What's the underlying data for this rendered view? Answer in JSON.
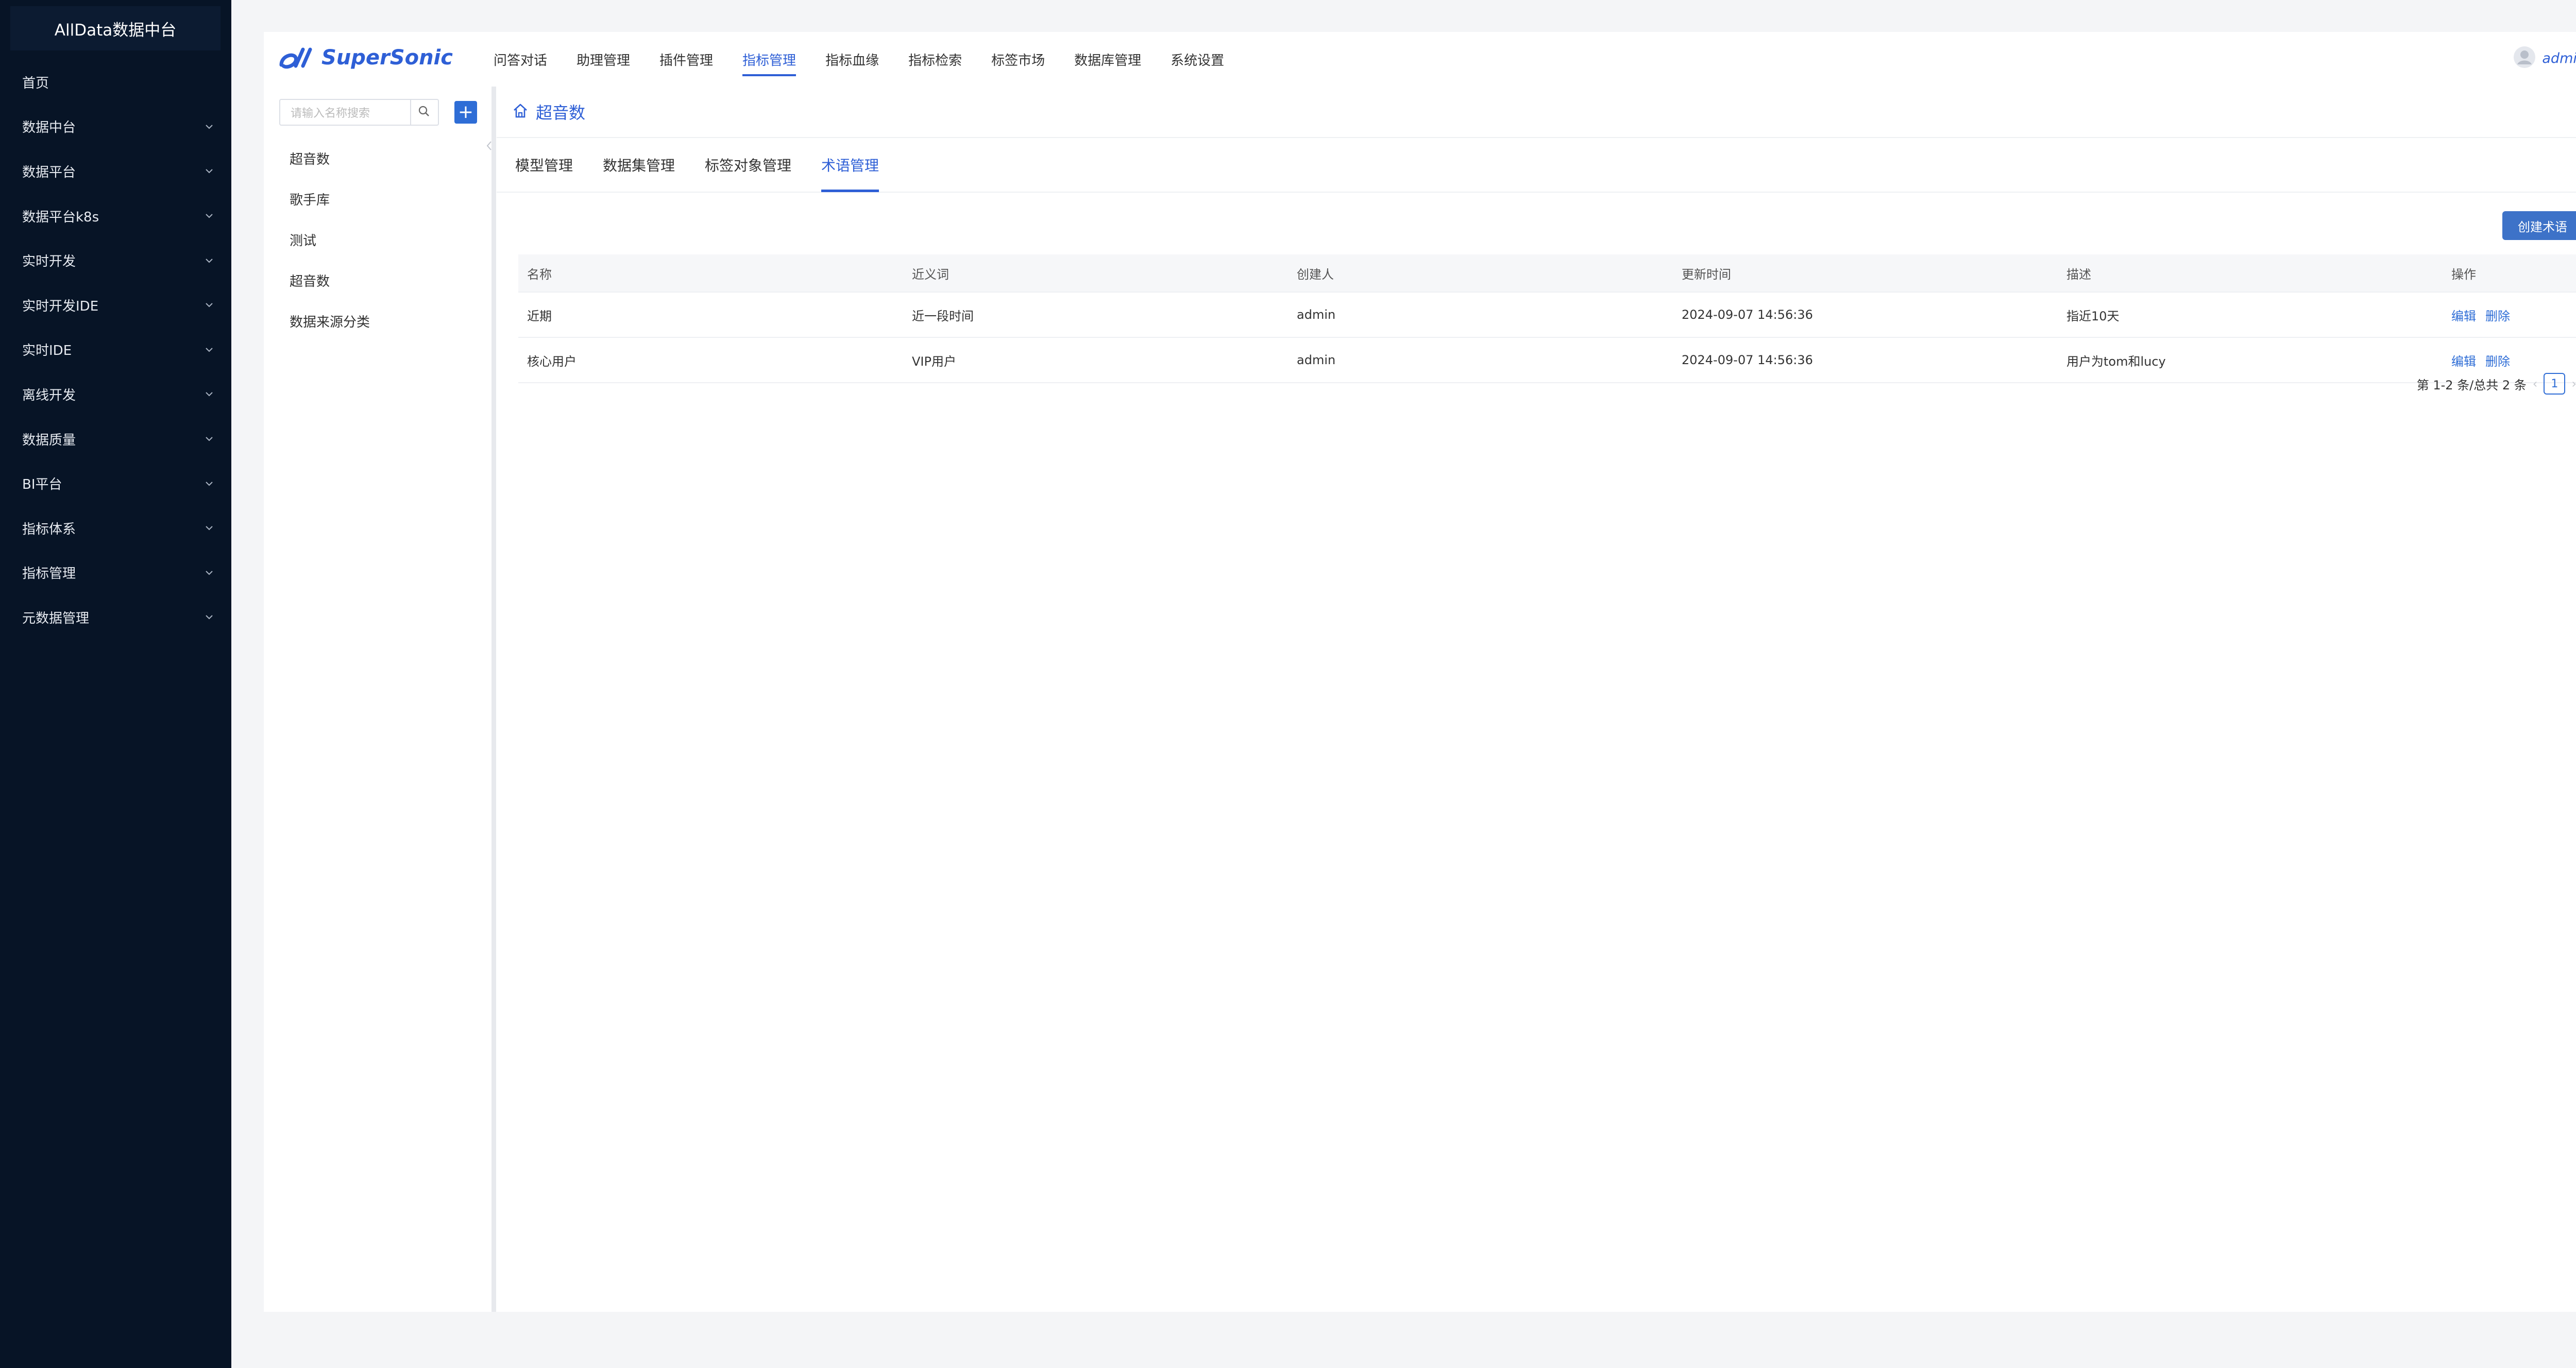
{
  "sidebar": {
    "title": "AllData数据中台",
    "items": [
      {
        "label": "首页",
        "chevron": false
      },
      {
        "label": "数据中台",
        "chevron": true
      },
      {
        "label": "数据平台",
        "chevron": true
      },
      {
        "label": "数据平台k8s",
        "chevron": true
      },
      {
        "label": "实时开发",
        "chevron": true
      },
      {
        "label": "实时开发IDE",
        "chevron": true
      },
      {
        "label": "实时IDE",
        "chevron": true
      },
      {
        "label": "离线开发",
        "chevron": true
      },
      {
        "label": "数据质量",
        "chevron": true
      },
      {
        "label": "BI平台",
        "chevron": true
      },
      {
        "label": "指标体系",
        "chevron": true
      },
      {
        "label": "指标管理",
        "chevron": true
      },
      {
        "label": "元数据管理",
        "chevron": true
      }
    ]
  },
  "header": {
    "logo_text": "SuperSonic",
    "nav": [
      "问答对话",
      "助理管理",
      "插件管理",
      "指标管理",
      "指标血缘",
      "指标检索",
      "标签市场",
      "数据库管理",
      "系统设置"
    ],
    "active_nav": "指标管理",
    "user": "admin"
  },
  "tree": {
    "search_placeholder": "请输入名称搜索",
    "add_label": "+",
    "items": [
      "超音数",
      "歌手库",
      "测试",
      "超音数",
      "数据来源分类"
    ]
  },
  "content": {
    "breadcrumb": "超音数",
    "tabs": [
      "模型管理",
      "数据集管理",
      "标签对象管理",
      "术语管理"
    ],
    "active_tab": "术语管理",
    "create_button": "创建术语",
    "table": {
      "columns": [
        "名称",
        "近义词",
        "创建人",
        "更新时间",
        "描述",
        "操作"
      ],
      "rows": [
        {
          "name": "近期",
          "synonym": "近一段时间",
          "creator": "admin",
          "updated": "2024-09-07 14:56:36",
          "desc": "指近10天",
          "edit": "编辑",
          "delete": "删除"
        },
        {
          "name": "核心用户",
          "synonym": "VIP用户",
          "creator": "admin",
          "updated": "2024-09-07 14:56:36",
          "desc": "用户为tom和lucy",
          "edit": "编辑",
          "delete": "删除"
        }
      ]
    },
    "pagination": {
      "summary": "第 1-2 条/总共 2 条",
      "current_page": "1",
      "prev": "‹",
      "next": "›"
    }
  },
  "colors": {
    "accent": "#2e5fd6",
    "sidebar_bg": "#071426",
    "fab": "#2a47d8"
  }
}
